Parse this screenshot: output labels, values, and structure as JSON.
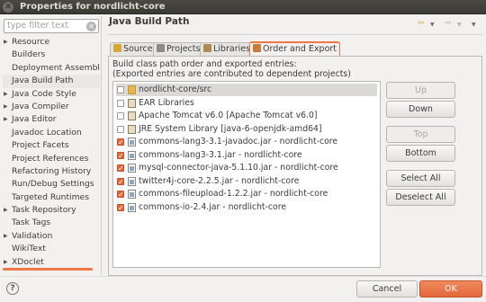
{
  "window": {
    "title": "Properties for nordlicht-core",
    "close_glyph": "✕"
  },
  "filter": {
    "placeholder": "type filter text",
    "clear_glyph": "✕"
  },
  "tree": {
    "items": [
      {
        "label": "Resource",
        "expandable": true
      },
      {
        "label": "Builders",
        "expandable": false
      },
      {
        "label": "Deployment Assembly",
        "expandable": false
      },
      {
        "label": "Java Build Path",
        "expandable": false,
        "selected": true
      },
      {
        "label": "Java Code Style",
        "expandable": true
      },
      {
        "label": "Java Compiler",
        "expandable": true
      },
      {
        "label": "Java Editor",
        "expandable": true
      },
      {
        "label": "Javadoc Location",
        "expandable": false
      },
      {
        "label": "Project Facets",
        "expandable": false
      },
      {
        "label": "Project References",
        "expandable": false
      },
      {
        "label": "Refactoring History",
        "expandable": false
      },
      {
        "label": "Run/Debug Settings",
        "expandable": false
      },
      {
        "label": "Targeted Runtimes",
        "expandable": false
      },
      {
        "label": "Task Repository",
        "expandable": true
      },
      {
        "label": "Task Tags",
        "expandable": false
      },
      {
        "label": "Validation",
        "expandable": true
      },
      {
        "label": "WikiText",
        "expandable": false
      },
      {
        "label": "XDoclet",
        "expandable": true
      }
    ]
  },
  "page": {
    "title": "Java Build Path",
    "nav": {
      "back": "⇦",
      "fwd": "⇨",
      "dropdown": "▼"
    }
  },
  "tabs": [
    {
      "label": "Source",
      "icon": "source-folder-icon",
      "color": "#d6a83c"
    },
    {
      "label": "Projects",
      "icon": "projects-icon",
      "color": "#8c8a85"
    },
    {
      "label": "Libraries",
      "icon": "libraries-icon",
      "color": "#b08a4a"
    },
    {
      "label": "Order and Export",
      "icon": "order-export-icon",
      "color": "#c87a3c",
      "active": true
    }
  ],
  "order_export": {
    "description_line1": "Build class path order and exported entries:",
    "description_line2": "(Exported entries are contributed to dependent projects)",
    "entries": [
      {
        "label": "nordlicht-core/src",
        "checked": false,
        "icon": "source-folder-icon",
        "selected": true,
        "type": "folder"
      },
      {
        "label": "EAR Libraries",
        "checked": false,
        "icon": "library-icon",
        "type": "lib"
      },
      {
        "label": "Apache Tomcat v6.0 [Apache Tomcat v6.0]",
        "checked": false,
        "icon": "library-icon",
        "type": "lib"
      },
      {
        "label": "JRE System Library [java-6-openjdk-amd64]",
        "checked": false,
        "icon": "library-icon",
        "type": "lib"
      },
      {
        "label": "commons-lang3-3.1-javadoc.jar - nordlicht-core",
        "checked": true,
        "icon": "jar-icon",
        "type": "jar"
      },
      {
        "label": "commons-lang3-3.1.jar - nordlicht-core",
        "checked": true,
        "icon": "jar-icon",
        "type": "jar"
      },
      {
        "label": "mysql-connector-java-5.1.10.jar - nordlicht-core",
        "checked": true,
        "icon": "jar-icon",
        "type": "jar"
      },
      {
        "label": "twitter4j-core-2.2.5.jar - nordlicht-core",
        "checked": true,
        "icon": "jar-icon",
        "type": "jar"
      },
      {
        "label": "commons-fileupload-1.2.2.jar - nordlicht-core",
        "checked": true,
        "icon": "jar-icon",
        "type": "jar"
      },
      {
        "label": "commons-io-2.4.jar - nordlicht-core",
        "checked": true,
        "icon": "jar-icon",
        "type": "jar"
      }
    ],
    "buttons": {
      "up": "Up",
      "down": "Down",
      "top": "Top",
      "bottom": "Bottom",
      "select_all": "Select All",
      "deselect_all": "Deselect All"
    }
  },
  "dialog": {
    "help": "?",
    "cancel": "Cancel",
    "ok": "OK"
  },
  "colors": {
    "accent": "#e2683c",
    "title_bar": "#3c3b37"
  }
}
